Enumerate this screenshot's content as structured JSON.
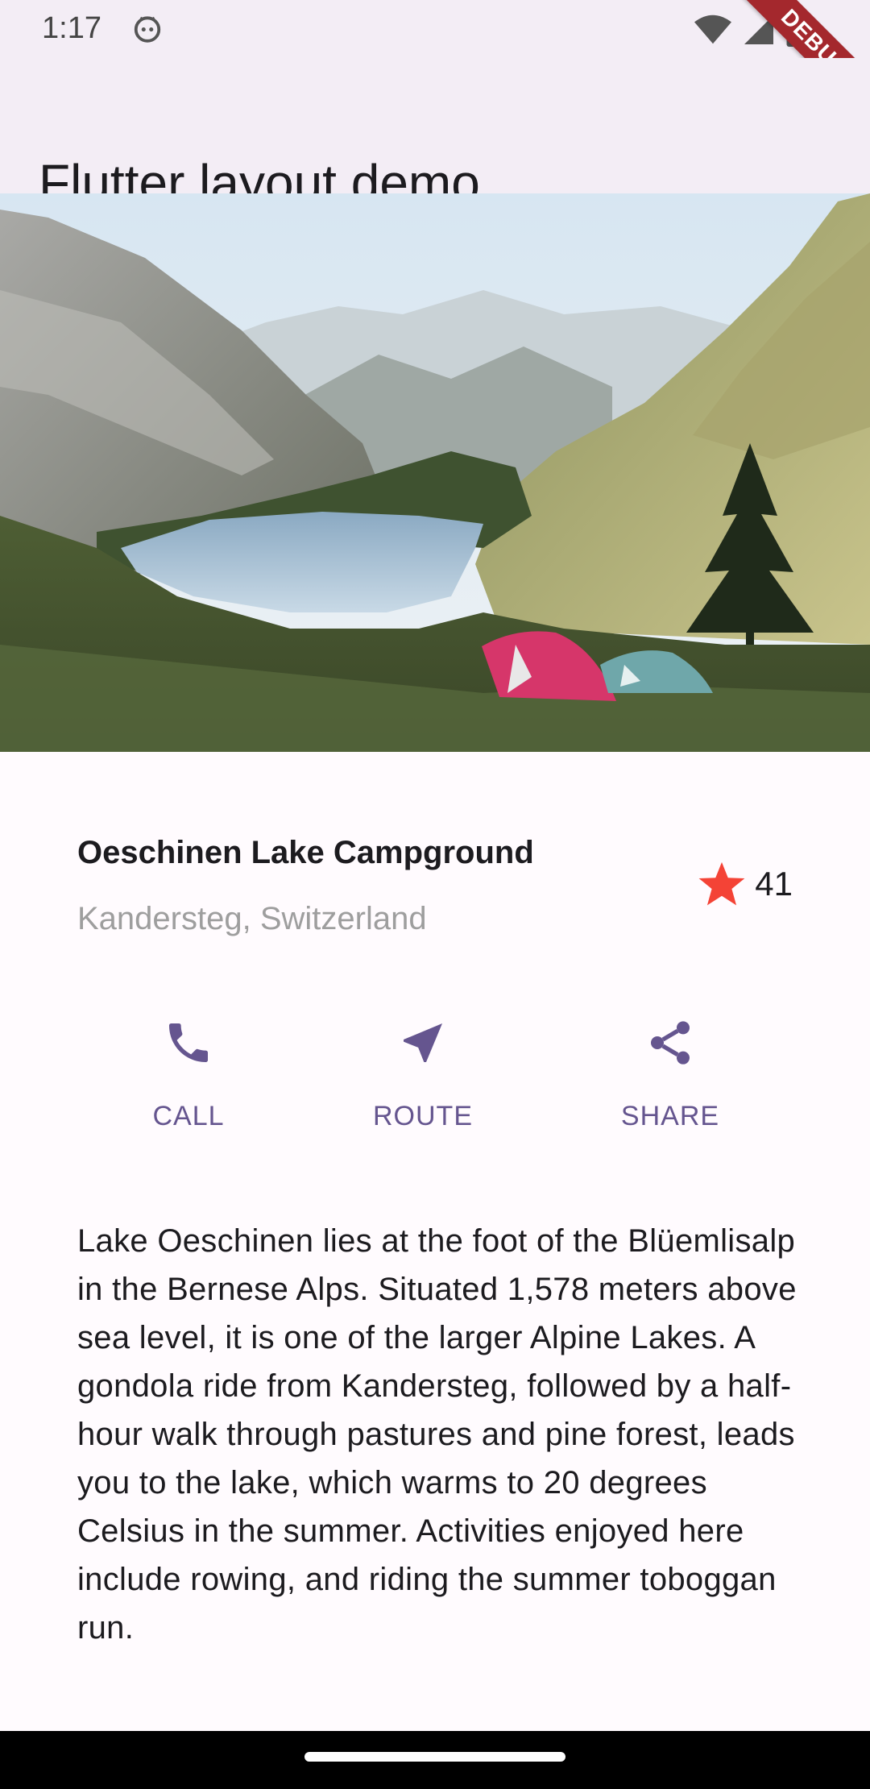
{
  "status_bar": {
    "time": "1:17",
    "icons": [
      "notification-face-icon",
      "wifi-icon",
      "cell-signal-icon",
      "battery-icon"
    ]
  },
  "debug_banner": "DEBUG",
  "app_bar": {
    "title": "Flutter layout demo"
  },
  "hero_image": {
    "subject": "mountain-lake-campground-photo"
  },
  "place": {
    "name": "Oeschinen Lake Campground",
    "location": "Kandersteg, Switzerland",
    "rating_count": "41",
    "star_color": "#f44336"
  },
  "actions": [
    {
      "label": "CALL",
      "icon": "phone-icon"
    },
    {
      "label": "ROUTE",
      "icon": "navigation-icon"
    },
    {
      "label": "SHARE",
      "icon": "share-icon"
    }
  ],
  "accent_color": "#65558f",
  "description": "Lake Oeschinen lies at the foot of the Blüemlisalp in the Bernese Alps. Situated 1,578 meters above sea level, it is one of the larger Alpine Lakes. A gondola ride from Kandersteg, followed by a half-hour walk through pastures and pine forest, leads you to the lake, which warms to 20 degrees Celsius in the summer. Activities enjoyed here include rowing, and riding the summer toboggan run."
}
